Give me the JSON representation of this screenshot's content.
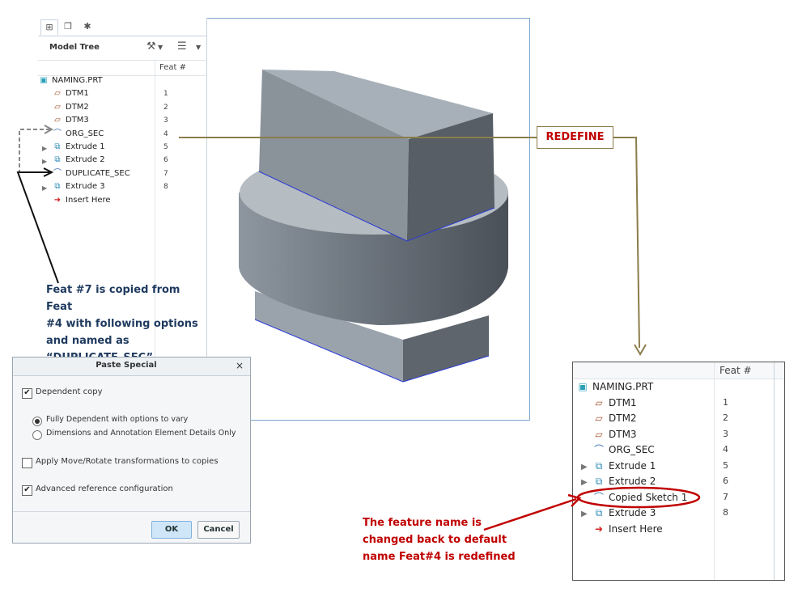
{
  "tree_small": {
    "title": "Model Tree",
    "col_feat": "Feat #",
    "root": "NAMING.PRT",
    "items": [
      {
        "label": "DTM1",
        "num": "1"
      },
      {
        "label": "DTM2",
        "num": "2"
      },
      {
        "label": "DTM3",
        "num": "3"
      },
      {
        "label": "ORG_SEC",
        "num": "4"
      },
      {
        "label": "Extrude 1",
        "num": "5"
      },
      {
        "label": "Extrude 2",
        "num": "6"
      },
      {
        "label": "DUPLICATE_SEC",
        "num": "7"
      },
      {
        "label": "Extrude 3",
        "num": "8"
      }
    ],
    "insert": "Insert Here"
  },
  "tree_big": {
    "col_feat": "Feat #",
    "root": "NAMING.PRT",
    "items": [
      {
        "label": "DTM1",
        "num": "1"
      },
      {
        "label": "DTM2",
        "num": "2"
      },
      {
        "label": "DTM3",
        "num": "3"
      },
      {
        "label": "ORG_SEC",
        "num": "4"
      },
      {
        "label": "Extrude 1",
        "num": "5"
      },
      {
        "label": "Extrude 2",
        "num": "6"
      },
      {
        "label": "Copied Sketch 1",
        "num": "7"
      },
      {
        "label": "Extrude 3",
        "num": "8"
      }
    ],
    "insert": "Insert Here"
  },
  "dialog": {
    "title": "Paste Special",
    "close": "×",
    "dependent_copy": "Dependent copy",
    "fully_dependent": "Fully Dependent with options to vary",
    "dims_only": "Dimensions and Annotation Element Details Only",
    "apply_move": "Apply Move/Rotate transformations to copies",
    "advanced_ref": "Advanced reference configuration",
    "ok": "OK",
    "cancel": "Cancel"
  },
  "annotations": {
    "note_copy_1": "Feat #7 is copied  from Feat",
    "note_copy_2": "#4 with following  options",
    "note_copy_3": "and named as",
    "note_copy_4": "“DUPLICATE_SEC”",
    "redefine": "REDEFINE",
    "note_name_1": "The feature name is",
    "note_name_2": "changed back to default",
    "note_name_3": "name Feat#4 is redefined"
  },
  "colors": {
    "red": "#c00000",
    "navy": "#1f3a5f",
    "olive": "#8b7d4a",
    "frame": "#7aa3cc"
  },
  "icons": {
    "datum_plane": "datum-plane-icon",
    "sketch": "sketch-icon",
    "extrude": "extrude-icon",
    "part": "part-icon",
    "insert": "insert-arrow-icon"
  }
}
